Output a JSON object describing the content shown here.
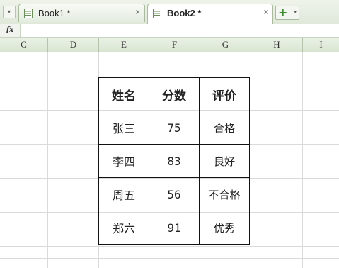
{
  "tabs": [
    {
      "label": "Book1 *",
      "close": "×"
    },
    {
      "label": "Book2 *",
      "close": "×"
    }
  ],
  "new_tab": {
    "plus": "+",
    "caret": "▾"
  },
  "tab_menu_caret": "▾",
  "formula_bar": {
    "fx_label": "fx",
    "value": ""
  },
  "columns": [
    "C",
    "D",
    "E",
    "F",
    "G",
    "H",
    "I"
  ],
  "table": {
    "headers": [
      "姓名",
      "分数",
      "评价"
    ],
    "rows": [
      [
        "张三",
        "75",
        "合格"
      ],
      [
        "李四",
        "83",
        "良好"
      ],
      [
        "周五",
        "56",
        "不合格"
      ],
      [
        "郑六",
        "91",
        "优秀"
      ]
    ]
  },
  "colors": {
    "tab_accent": "#3a8a2e",
    "grid_line": "#dadada",
    "header_bg": "#d9e5d2"
  }
}
